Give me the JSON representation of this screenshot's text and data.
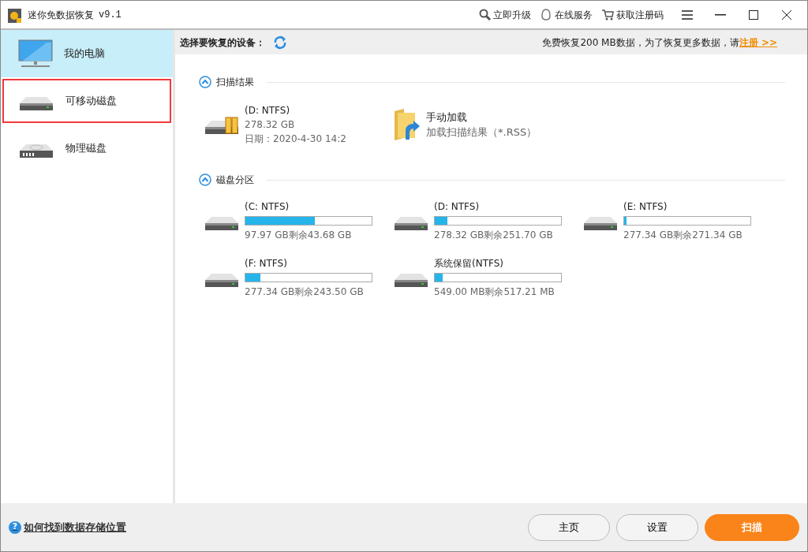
{
  "window": {
    "title": "迷你免数据恢复",
    "version": "v9.1",
    "actions": [
      {
        "kind": "upgrade",
        "label": "立即升级"
      },
      {
        "kind": "service",
        "label": "在线服务"
      },
      {
        "kind": "cart",
        "label": "获取注册码"
      }
    ]
  },
  "sidebar": {
    "items": [
      {
        "kind": "computer",
        "label": "我的电脑",
        "selected": true,
        "highlighted": false
      },
      {
        "kind": "removable",
        "label": "可移动磁盘",
        "selected": false,
        "highlighted": true
      },
      {
        "kind": "physical",
        "label": "物理磁盘",
        "selected": false,
        "highlighted": false
      }
    ]
  },
  "header": {
    "label": "选择要恢复的设备：",
    "notice": "免费恢复200 MB数据，为了恢复更多数据，请",
    "register_link": "注册 >>"
  },
  "scan_results": {
    "title": "扫描结果",
    "expanded": true,
    "items": [
      {
        "kind": "scan",
        "name": "(D: NTFS)",
        "size": "278.32 GB",
        "date": "日期：2020-4-30 14:2"
      },
      {
        "kind": "load",
        "name": "手动加载",
        "size": "加载扫描结果（*.RSS）"
      }
    ]
  },
  "partitions": {
    "title": "磁盘分区",
    "expanded": true,
    "items": [
      {
        "name": "(C: NTFS)",
        "level": 0.55,
        "usage": "97.97 GB剩余43.68 GB"
      },
      {
        "name": "(D: NTFS)",
        "level": 0.1,
        "usage": "278.32 GB剩余251.70 GB"
      },
      {
        "name": "(E: NTFS)",
        "level": 0.02,
        "usage": "277.34 GB剩余271.34 GB"
      },
      {
        "name": "(F: NTFS)",
        "level": 0.12,
        "usage": "277.34 GB剩余243.50 GB"
      },
      {
        "name": "系统保留(NTFS)",
        "level": 0.06,
        "usage": "549.00 MB剩余517.21 MB"
      }
    ]
  },
  "footer": {
    "help_icon": "?",
    "help_link": "如何找到数据存储位置",
    "buttons": [
      {
        "kind": "secondary",
        "label": "主页"
      },
      {
        "kind": "secondary",
        "label": "设置"
      },
      {
        "kind": "primary",
        "label": "扫描"
      }
    ]
  }
}
